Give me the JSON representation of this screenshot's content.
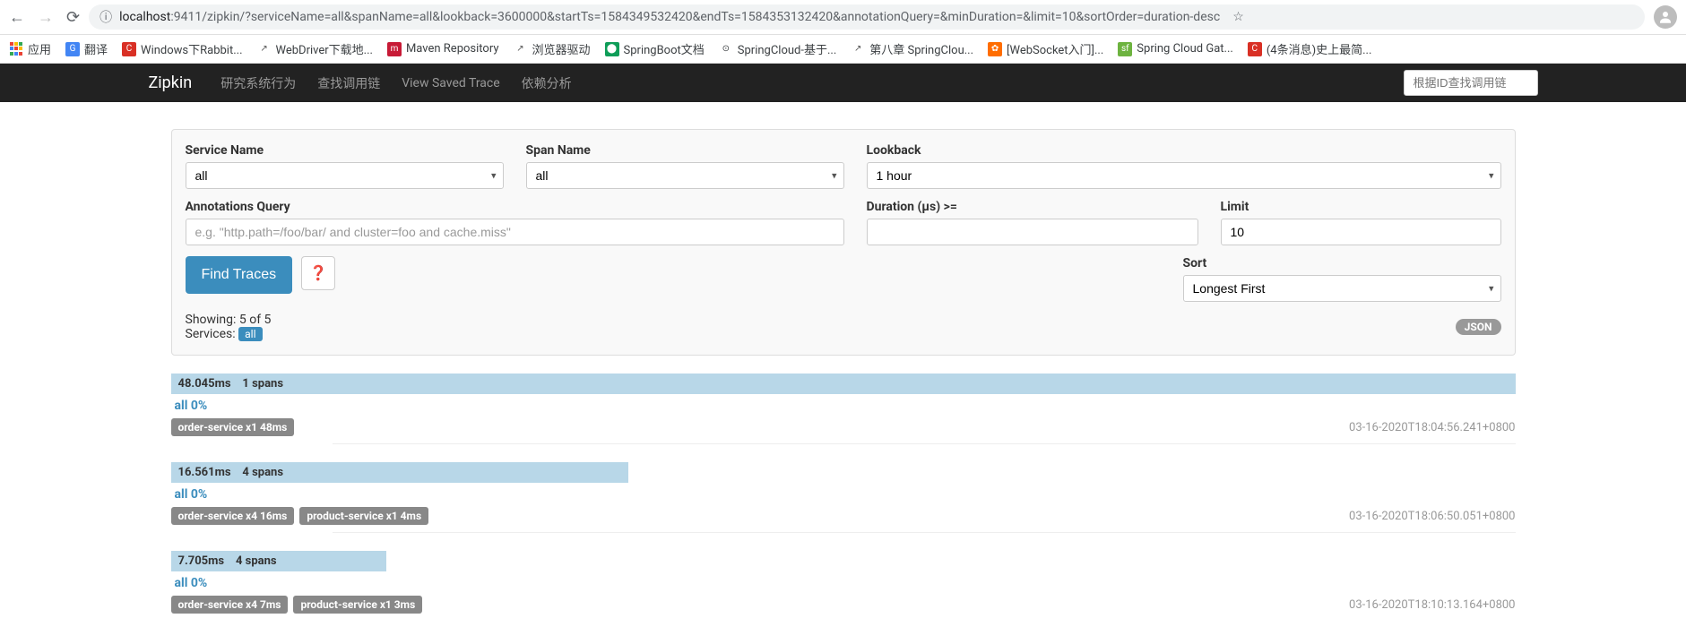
{
  "browser": {
    "url_host": "localhost",
    "url_rest": ":9411/zipkin/?serviceName=all&spanName=all&lookback=3600000&startTs=1584349532420&endTs=1584353132420&annotationQuery=&minDuration=&limit=10&sortOrder=duration-desc"
  },
  "bookmarks": {
    "apps": "应用",
    "translate": "翻译",
    "rabbit": "Windows下Rabbit...",
    "webdriver": "WebDriver下载地...",
    "maven": "Maven Repository",
    "browserdriver": "浏览器驱动",
    "springboot": "SpringBoot文档",
    "springcloud": "SpringCloud-基于...",
    "chapter8": "第八章 SpringClou...",
    "websocket": "[WebSocket入门]...",
    "springgateway": "Spring Cloud Gat...",
    "history": "(4条消息)史上最简..."
  },
  "nav": {
    "brand": "Zipkin",
    "study": "研究系统行为",
    "find": "查找调用链",
    "saved": "View Saved Trace",
    "deps": "依赖分析",
    "search_placeholder": "根据ID查找调用链"
  },
  "form": {
    "service_label": "Service Name",
    "service_value": "all",
    "span_label": "Span Name",
    "span_value": "all",
    "lookback_label": "Lookback",
    "lookback_value": "1 hour",
    "anno_label": "Annotations Query",
    "anno_placeholder": "e.g. \"http.path=/foo/bar/ and cluster=foo and cache.miss\"",
    "duration_label": "Duration (µs) >=",
    "limit_label": "Limit",
    "limit_value": "10",
    "sort_label": "Sort",
    "sort_value": "Longest First",
    "find_button": "Find Traces"
  },
  "summary": {
    "showing": "Showing: 5 of 5",
    "services_label": "Services:",
    "services_tag": "all",
    "json": "JSON"
  },
  "traces": [
    {
      "duration": "48.045ms",
      "spans": "1 spans",
      "bar_width": "100%",
      "service_pct": "all 0%",
      "tags": [
        "order-service x1 48ms"
      ],
      "timestamp": "03-16-2020T18:04:56.241+0800"
    },
    {
      "duration": "16.561ms",
      "spans": "4 spans",
      "bar_width": "34%",
      "service_pct": "all 0%",
      "tags": [
        "order-service x4 16ms",
        "product-service x1 4ms"
      ],
      "timestamp": "03-16-2020T18:06:50.051+0800"
    },
    {
      "duration": "7.705ms",
      "spans": "4 spans",
      "bar_width": "16%",
      "service_pct": "all 0%",
      "tags": [
        "order-service x4 7ms",
        "product-service x1 3ms"
      ],
      "timestamp": "03-16-2020T18:10:13.164+0800"
    }
  ]
}
